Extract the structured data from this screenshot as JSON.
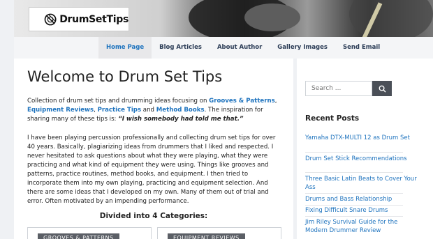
{
  "site": {
    "logo_text": "DrumSetTips"
  },
  "nav": {
    "items": [
      {
        "label": "Home Page"
      },
      {
        "label": "Blog Articles"
      },
      {
        "label": "About Author"
      },
      {
        "label": "Gallery Images"
      },
      {
        "label": "Send Email"
      }
    ],
    "active": "Home Page"
  },
  "main": {
    "title": "Welcome to Drum Set Tips",
    "intro": {
      "text_1": "Collection of drum set tips and drumming ideas focusing on ",
      "link_grooves": "Grooves & Patterns",
      "sep_1": ", ",
      "link_equipment": "Equipment Reviews",
      "sep_2": ", ",
      "link_practice": "Practice Tips",
      "and": " and ",
      "link_method": "Method Books",
      "text_2": ". The inspiration for sharing many of these tips is: ",
      "quote": "“I wish somebody had told me that.”"
    },
    "paragraph_2": "I have been playing percussion professionally and collecting drum set tips for over 40 years. Basically, plagiarizing ideas from drummers that I liked and respected. I never hesitated to ask questions about what they were playing, what they were practicing and what kind of equipment they were using. Things like grooves and patterns, practice routines, method books, and equipment. I then tried to incorporate them into my own playing, practicing and equipment selection. And there are some ideas that I developed on my own. Many of them out of trial and error. Often motivated by an impending performance.",
    "categories_heading": "Divided into 4 Categories:",
    "category_buttons": [
      "GROOVES & PATTERNS",
      "EQUIPMENT REVIEWS"
    ]
  },
  "sidebar": {
    "search_placeholder": "Search ...",
    "recent_heading": "Recent Posts",
    "posts": [
      "Yamaha DTX-MULTI 12 as Drum Set",
      "Drum Set Stick Recommendations",
      "Three Basic Latin Beats to Cover Your Ass",
      "Drums and Bass Relationship",
      "Fixing Difficult Snare Drums",
      "Jim Riley Survival Guide for the Modern Drummer Review"
    ]
  },
  "colors": {
    "accent": "#1e73be",
    "nav_text": "#2a3b55",
    "page_bg": "#eff1f4",
    "button_dark": "#4a4f57"
  }
}
